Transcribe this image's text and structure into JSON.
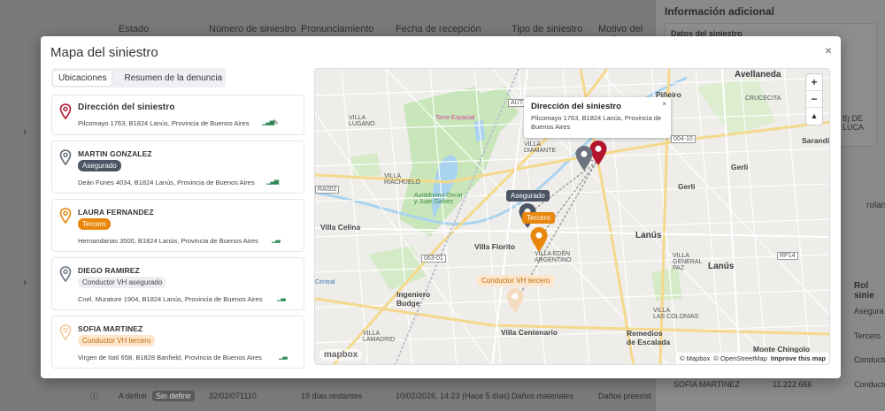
{
  "background": {
    "columns": [
      "Estado",
      "Número de siniestro",
      "Pronunciamiento",
      "Fecha de recepción",
      "Tipo de siniestro",
      "Motivo del anál"
    ],
    "panel_title": "Información adicional",
    "card_title": "Datos del siniestro",
    "partial_lucas": "8) DE LUCA",
    "partial_rolan": "rolan",
    "rol_header": "Rol sinie",
    "rol_values": [
      "Asegura",
      "Tercero",
      "Conducto",
      "Conducto"
    ],
    "sofia_row": {
      "name": "SOFIA MARTINEZ",
      "dni": "11.222.666"
    },
    "bottom_row": {
      "estado": "A definir",
      "chip": "Sin definir",
      "numero": "32/02/071110",
      "dias": "19 días restantes",
      "fecha": "10/02/2026, 14:23 (Hace 5 días)",
      "tipo": "Daños materiales",
      "motivo": "Daños preexist"
    }
  },
  "modal": {
    "title": "Mapa del siniestro",
    "close": "×",
    "tabs": [
      {
        "label": "Ubicaciones",
        "active": true
      },
      {
        "label": "Resumen de la denuncia",
        "active": false
      }
    ],
    "locations": [
      {
        "name": "Dirección del siniestro",
        "badge": "",
        "address": "Pilcomayo 1763, B1824 Lanús, Provincia de Buenos Aires",
        "pin_color": "#b3142c"
      },
      {
        "name": "MARTIN GONZALEZ",
        "badge": "Asegurado",
        "address": "Deán Funes 4034, B1824 Lanús, Provincia de Buenos Aires",
        "pin_color": "#5f6670"
      },
      {
        "name": "LAURA FERNANDEZ",
        "badge": "Tercero",
        "address": "Hernandarias 3500, B1824 Lanús, Provincia de Buenos Aires",
        "pin_color": "#e8870c"
      },
      {
        "name": "DIEGO RAMIREZ",
        "badge": "Conductor VH asegurado",
        "address": "Cnel. Murature 1904, B1824 Lanús, Provincia de Buenos Aires",
        "pin_color": "#6b7280"
      },
      {
        "name": "SOFIA MARTINEZ",
        "badge": "Conductor VH tercero",
        "address": "Virgen de Itatí 658, B1828 Banfield, Provincia de Buenos Aires",
        "pin_color": "#f6c99a"
      }
    ]
  },
  "map": {
    "popup": {
      "title": "Dirección del siniestro",
      "address": "Pilcomayo 1763, B1824 Lanús, Provincia de Buenos Aires",
      "close": "×"
    },
    "marker_tags": {
      "asegurado": "Asegurado",
      "tercero": "Tercero",
      "conductor_tercero": "Conductor VH tercero",
      "partial": "Conductor VH asegurado"
    },
    "labels": {
      "avellaneda": "Avellaneda",
      "pineiro": "Piñeiro",
      "crucecita": "CRUCECITA",
      "villa_lugano": "VILLA\nLUGANO",
      "torre": "Torre Espacial",
      "villa_riachuelo": "VILLA\nRIACHUELO",
      "villa_diamante": "VILLA\nDIAMANTE",
      "autodromo": "Autódromo Oscar\ny Juan Gálvez",
      "villa_celina": "Villa Celina",
      "villa_fiorito": "Villa Fiorito",
      "villa_eden": "VILLA EDÉN\nARGENTINO",
      "lanus": "Lanús",
      "lanus2": "Lanús",
      "gerli": "Gerli",
      "gerli2": "Gerli",
      "sarandi": "Sarandí",
      "villa_general_paz": "VILLA\nGENERAL\nPAZ",
      "las_colonias": "VILLA\nLAS COLONIAS",
      "remedios": "Remedios\nde Escalada",
      "villa_centenario": "Villa Centenario",
      "ingeniero_budge": "Ingeniero\nBudge",
      "villa_lamadrid": "VILLA\nLAMADRID",
      "central": "Central",
      "monte_chingolo": "Monte Chingolo",
      "au7": "AU7",
      "r004": "004-10",
      "rp14": "RP14",
      "ra002": "RA002",
      "r063": "063-01"
    },
    "zoom_in": "+",
    "zoom_out": "−",
    "compass": "▲",
    "logo": "mapbox",
    "attribution": [
      "© Mapbox",
      "© OpenStreetMap",
      "Improve this map"
    ]
  }
}
